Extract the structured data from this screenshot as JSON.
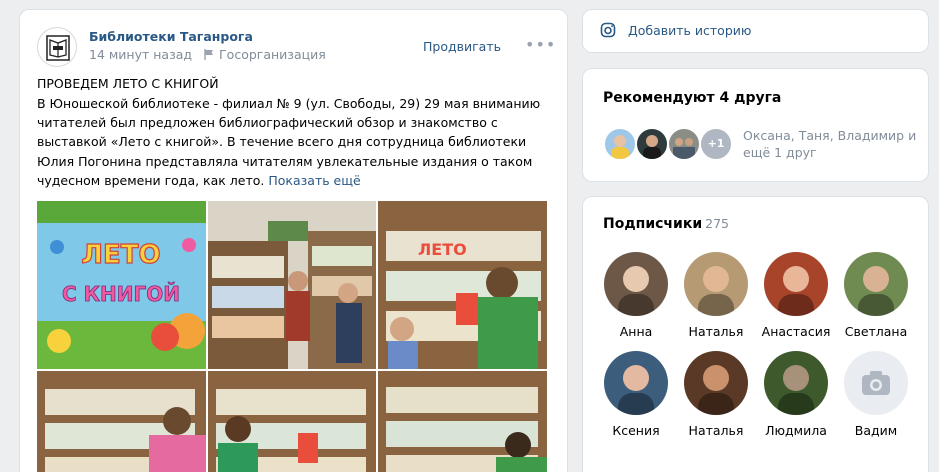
{
  "post": {
    "author": "Библиотеки Таганрога",
    "time": "14 минут назад",
    "org": "Госорганизация",
    "promote": "Продвигать",
    "more": "•••",
    "title": "ПРОВЕДЕМ ЛЕТО С КНИГОЙ",
    "text": "В Юношеской библиотеке - филиал № 9 (ул. Свободы, 29) 29 мая вниманию читателей был предложен библиографический обзор и знакомство с выставкой «Лето с книгой». В течение всего дня сотрудница библиотеки Юлия Погонина представляла читателям увлекательные издания о таком чудесном времени года, как лето.",
    "show_more": "Показать ещё",
    "photo_banner_line1": "ЛЕТО",
    "photo_banner_line2": "С КНИГОЙ",
    "shelf_sign": "ЛЕТО"
  },
  "story": {
    "label": "Добавить историю"
  },
  "recommend": {
    "title": "Рекомендуют 4 друга",
    "plus": "+1",
    "names": "Оксана, Таня, Владимир и ещё 1 друг"
  },
  "subscribers": {
    "title": "Подписчики",
    "count": "275",
    "items": [
      {
        "name": "Анна",
        "bg": "#6d5848",
        "face": "#e7c9b0"
      },
      {
        "name": "Наталья",
        "bg": "#b59a74",
        "face": "#e2b894"
      },
      {
        "name": "Анастасия",
        "bg": "#a8442a",
        "face": "#e9b69a"
      },
      {
        "name": "Светлана",
        "bg": "#6f8b52",
        "face": "#d9b294"
      },
      {
        "name": "Ксения",
        "bg": "#3c5d7c",
        "face": "#e3b9a1"
      },
      {
        "name": "Наталья",
        "bg": "#5a3a26",
        "face": "#c9926d"
      },
      {
        "name": "Людмила",
        "bg": "#3e5a2c",
        "face": "#a8917a"
      },
      {
        "name": "Вадим",
        "bg": "",
        "face": ""
      }
    ]
  },
  "colors": {
    "link": "#2a5885",
    "muted": "#818c99",
    "page_bg": "#edeef0"
  }
}
